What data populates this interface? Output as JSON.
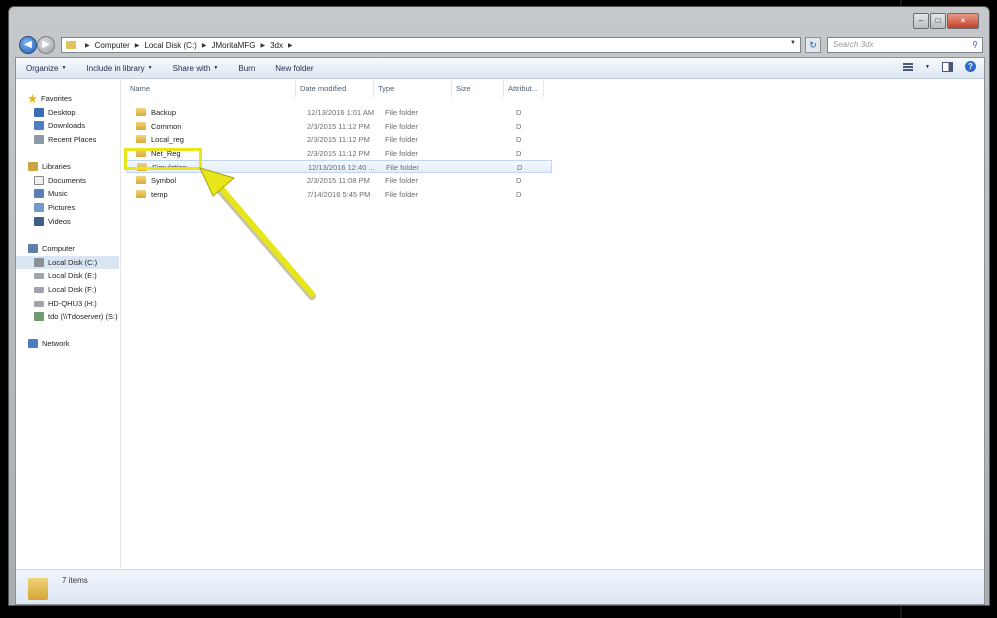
{
  "window": {
    "controls": {
      "minimize": "–",
      "maximize": "□",
      "close": "×"
    }
  },
  "navigation": {
    "back_icon": "back-arrow-icon",
    "forward_icon": "forward-arrow-icon",
    "breadcrumbs": [
      "Computer",
      "Local Disk (C:)",
      "JMoritaMFG",
      "3dx"
    ],
    "search_placeholder": "Search 3dx"
  },
  "toolbar": {
    "organize": "Organize",
    "include_in_library": "Include in library",
    "share_with": "Share with",
    "burn": "Burn",
    "new_folder": "New folder"
  },
  "sidebar": {
    "favorites": "Favorites",
    "favorites_items": [
      "Desktop",
      "Downloads",
      "Recent Places"
    ],
    "libraries": "Libraries",
    "libraries_items": [
      "Documents",
      "Music",
      "Pictures",
      "Videos"
    ],
    "computer": "Computer",
    "computer_items": [
      "Local Disk (C:)",
      "Local Disk (E:)",
      "Local Disk (F:)",
      "HD-QHU3 (H:)",
      "tdo (\\\\Tdoserver) (S:)"
    ],
    "network": "Network"
  },
  "columns": {
    "name": "Name",
    "date_modified": "Date modified",
    "type": "Type",
    "size": "Size",
    "attributes": "Attribut..."
  },
  "files": [
    {
      "name": "Backup",
      "date": "12/13/2016 1:01 AM",
      "type": "File folder",
      "attr": "D"
    },
    {
      "name": "Common",
      "date": "2/3/2015 11:12 PM",
      "type": "File folder",
      "attr": "D"
    },
    {
      "name": "Local_reg",
      "date": "2/3/2015 11:12 PM",
      "type": "File folder",
      "attr": "D"
    },
    {
      "name": "Net_Reg",
      "date": "2/3/2015 11:12 PM",
      "type": "File folder",
      "attr": "D"
    },
    {
      "name": "Simulation",
      "date": "12/13/2016 12:40 ...",
      "type": "File folder",
      "attr": "D"
    },
    {
      "name": "Symbol",
      "date": "2/3/2015 11:08 PM",
      "type": "File folder",
      "attr": "D"
    },
    {
      "name": "temp",
      "date": "7/14/2016 5:45 PM",
      "type": "File folder",
      "attr": "D"
    }
  ],
  "status": {
    "item_count": "7 items"
  },
  "colors": {
    "annotation": "#e8e61a",
    "selection": "#dbe6f5"
  }
}
